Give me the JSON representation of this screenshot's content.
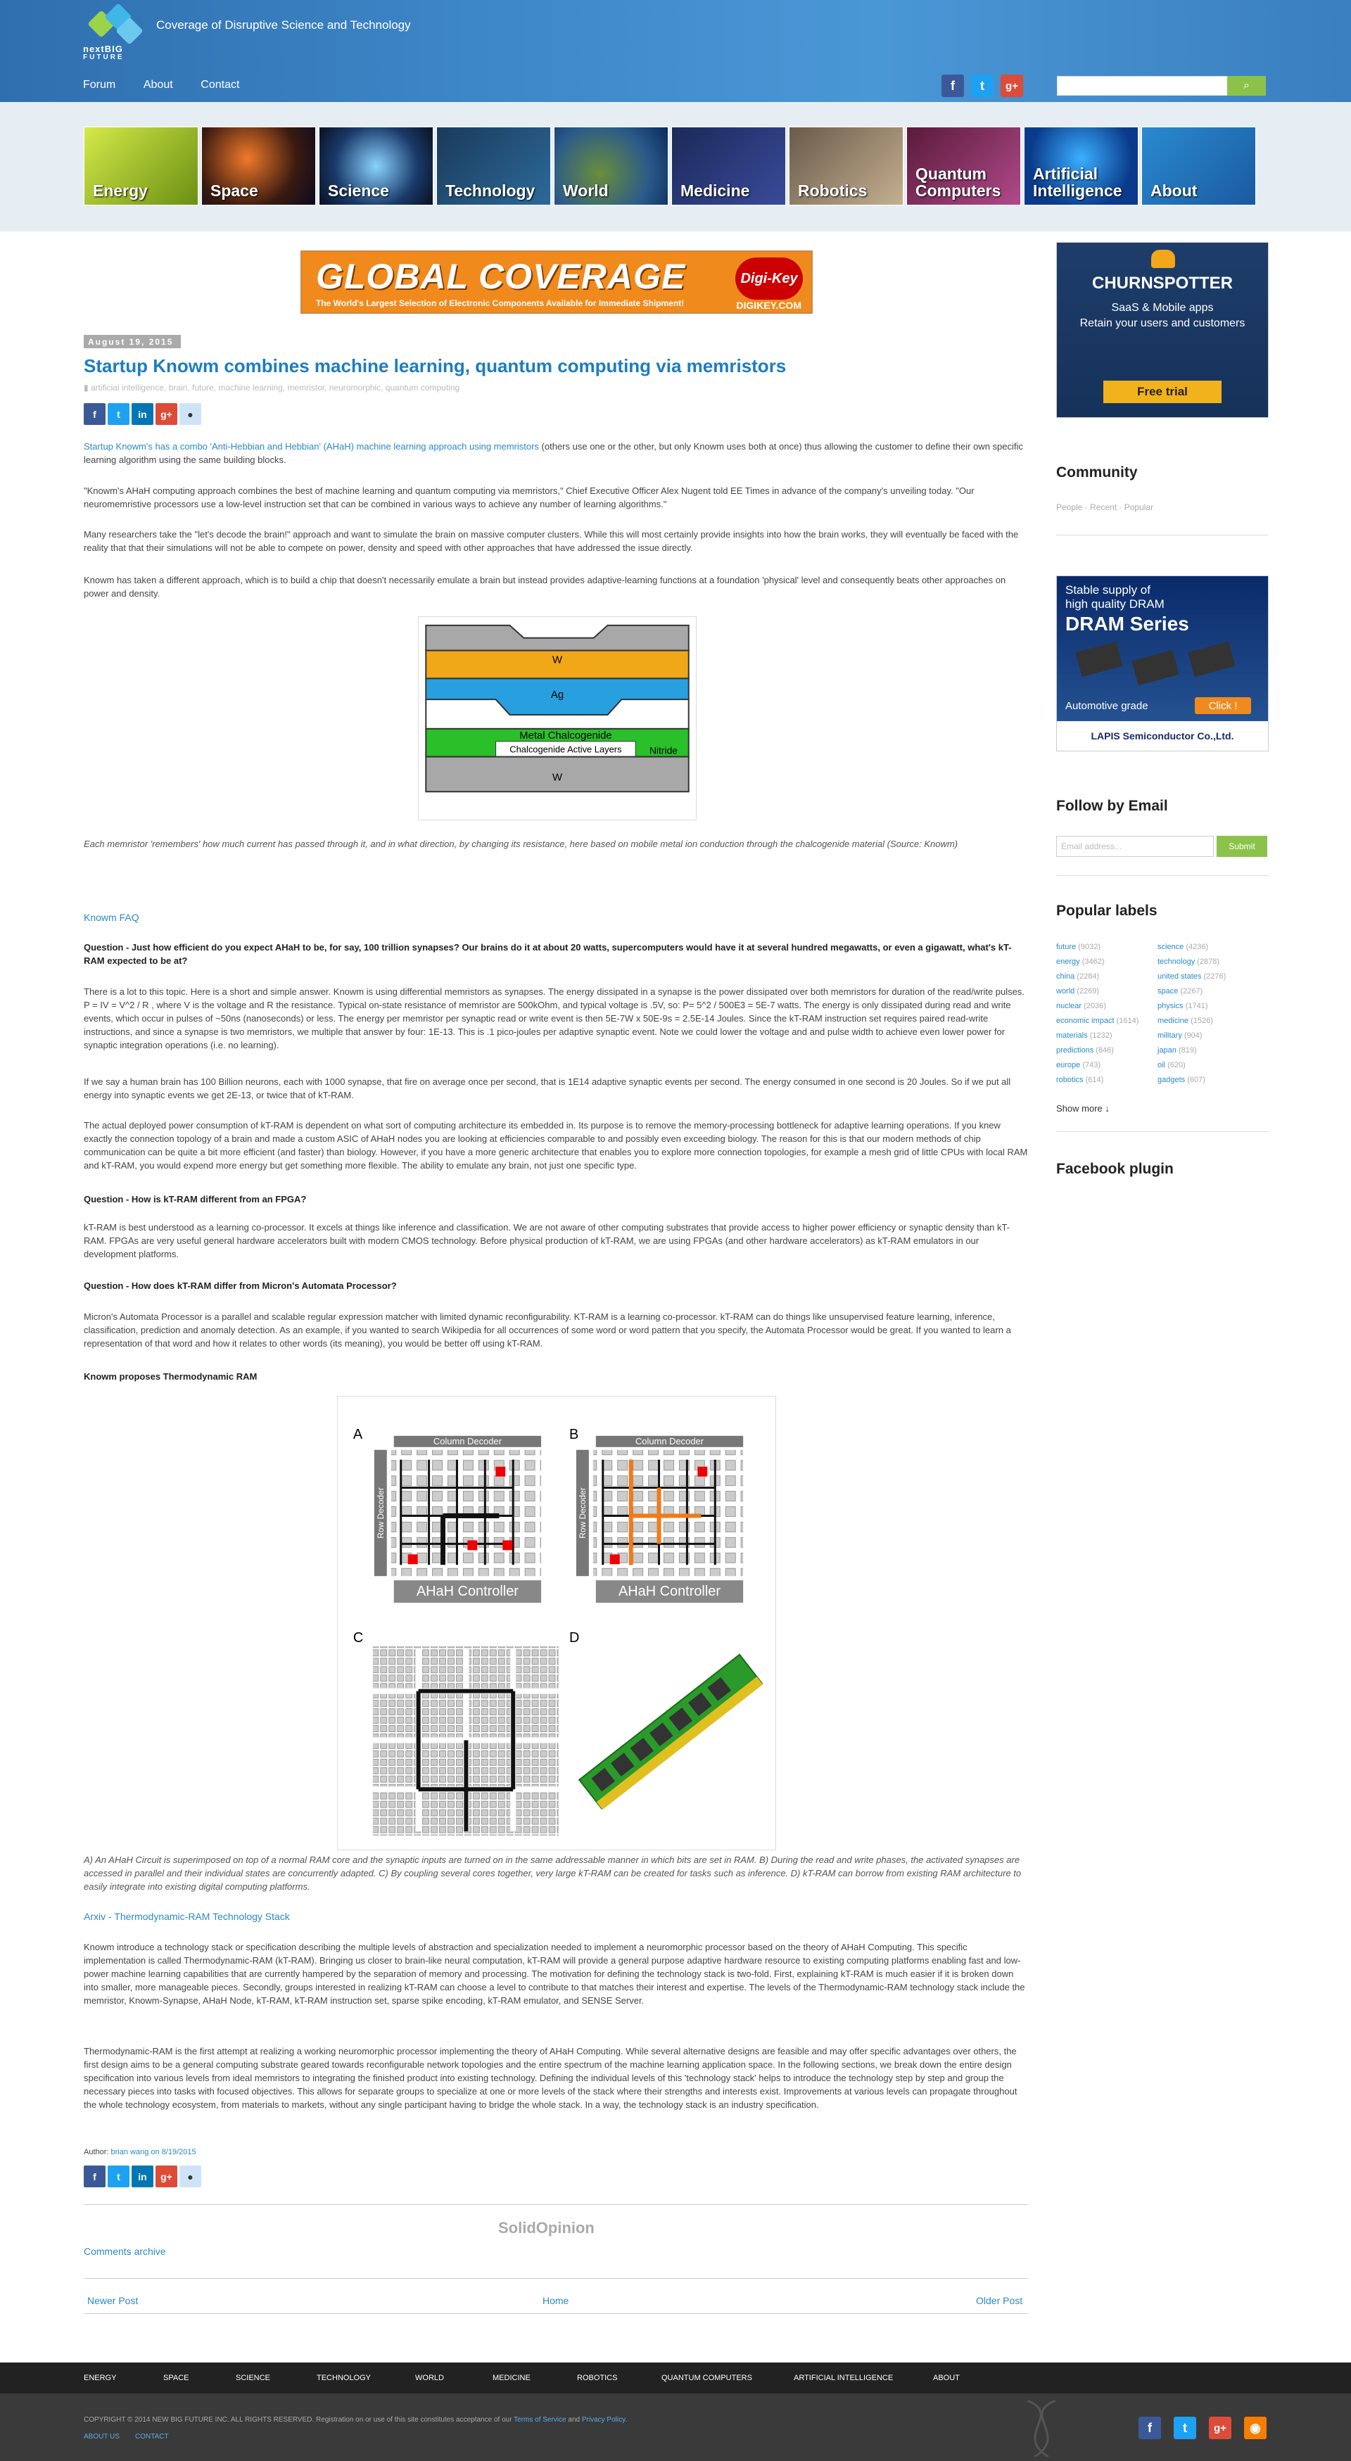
{
  "header": {
    "logo_line1": "nextBIG",
    "logo_line2": "FUTURE",
    "tagline": "Coverage of Disruptive Science and Technology",
    "nav": [
      "Forum",
      "About",
      "Contact"
    ],
    "search_button": "⌕"
  },
  "categories": [
    "Energy",
    "Space",
    "Science",
    "Technology",
    "World",
    "Medicine",
    "Robotics",
    "Quantum Computers",
    "Artificial Intelligence",
    "About"
  ],
  "banner_ad": {
    "headline": "GLOBAL COVERAGE",
    "subline": "The World's Largest Selection of Electronic Components Available for Immediate Shipment!",
    "brand": "Digi-Key",
    "url": "DIGIKEY.COM"
  },
  "article": {
    "date": "August 19, 2015",
    "title": "Startup Knowm combines machine learning, quantum computing via memristors",
    "tags": "artificial intelligence, brain, future, machine learning, memristor, neuromorphic, quantum computing",
    "p1_link": "Startup Knowm's has a combo 'Anti-Hebbian and Hebbian' (AHaH) machine learning approach using memristors",
    "p1_rest": " (others use one or the other, but only Knowm uses both at once) thus allowing the customer to define their own specific learning algorithm using the same building blocks.",
    "p2": "\"Knowm's AHaH computing approach combines the best of machine learning and quantum computing via memristors,\" Chief Executive Officer Alex Nugent told EE Times in advance of the company's unveiling today. \"Our neuromemristive processors use a low-level instruction set that can be combined in various ways to achieve any number of learning algorithms.\"",
    "p3": "Many researchers take the \"let's decode the brain!\" approach and want to simulate the brain on massive computer clusters. While this will most certainly provide insights into how the brain works, they will eventually be faced with the reality that that their simulations will not be able to compete on power, density and speed with other approaches that have addressed the issue directly.",
    "p4": "Knowm has taken a different approach, which is to build a chip that doesn't necessarily emulate a brain but instead provides adaptive-learning functions at a foundation 'physical' level and consequently beats other approaches on power and density.",
    "memristor_layers": [
      "W",
      "Ag",
      "Metal Chalcogenide",
      "Chalcogenide Active Layers",
      "Nitride",
      "W"
    ],
    "memristor_caption": "Each memristor 'remembers' how much current has passed through it, and in what direction, by changing its resistance, here based on mobile metal ion conduction through the chalcogenide material (Source: Knowm)",
    "faq_link": "Knowm FAQ",
    "q1": "Question - Just how efficient do you expect AHaH to be, for say, 100 trillion synapses? Our brains do it at about 20 watts, supercomputers would have it at several hundred megawatts, or even a gigawatt, what's kT-RAM expected to be at?",
    "a1a": "There is a lot to this topic. Here is a short and simple answer. Knowm is using differential memristors as synapses. The energy dissipated in a synapse is the power dissipated over both memristors for duration of the read/write pulses. P = IV = V^2 / R , where V is the voltage and R the resistance. Typical on-state resistance of memristor are 500kOhm, and typical voltage is .5V, so: P= 5^2 / 500E3 = 5E-7 watts. The energy is only dissipated during read and write events, which occur in pulses of ~50ns (nanoseconds) or less. The energy per memristor per synaptic read or write event is then 5E-7W x 50E-9s = 2.5E-14 Joules. Since the kT-RAM instruction set requires paired read-write instructions, and since a synapse is two memristors, we multiple that answer by four: 1E-13. This is .1 pico-joules per adaptive synaptic event. Note we could lower the voltage and and pulse width to achieve even lower power for synaptic integration operations (i.e. no learning).",
    "a1b": "If we say a human brain has 100 Billion neurons, each with 1000 synapse, that fire on average once per second, that is 1E14 adaptive synaptic events per second. The energy consumed in one second is 20 Joules. So if we put all energy into synaptic events we get 2E-13, or twice that of kT-RAM.",
    "a1c": "The actual deployed power consumption of kT-RAM is dependent on what sort of computing architecture its embedded in. Its purpose is to remove the memory-processing bottleneck for adaptive learning operations. If you knew exactly the connection topology of a brain and made a custom ASIC of AHaH nodes you are looking at efficiencies comparable to and possibly even exceeding biology. The reason for this is that our modern methods of chip communication can be quite a bit more efficient (and faster) than biology. However, if you have a more generic architecture that enables you to explore more connection topologies, for example a mesh grid of little CPUs with local RAM and kT-RAM, you would expend more energy but get something more flexible. The ability to emulate any brain, not just one specific type.",
    "q2": "Question - How is kT-RAM different from an FPGA?",
    "a2": "kT-RAM is best understood as a learning co-processor. It excels at things like inference and classification. We are not aware of other computing substrates that provide access to higher power efficiency or synaptic density than kT-RAM. FPGAs are very useful general hardware accelerators built with modern CMOS technology. Before physical production of kT-RAM, we are using FPGAs (and other hardware accelerators) as kT-RAM emulators in our development platforms.",
    "q3": "Question - How does kT-RAM differ from Micron's Automata Processor?",
    "a3": "Micron's Automata Processor is a parallel and scalable regular expression matcher with limited dynamic reconfigurability. KT-RAM is a learning co-processor. kT-RAM can do things like unsupervised feature learning, inference, classification, prediction and anomaly detection. As an example, if you wanted to search Wikipedia for all occurrences of some word or word pattern that you specify, the Automata Processor would be great. If you wanted to learn a representation of that word and how it relates to other words (its meaning), you would be better off using kT-RAM.",
    "thermo_heading": "Knowm proposes Thermodynamic RAM",
    "ktram_panels": [
      "A",
      "B",
      "C",
      "D"
    ],
    "ktram_col_decoder": "Column Decoder",
    "ktram_row_decoder": "Row Decoder",
    "ktram_controller": "AHaH Controller",
    "ktram_caption": "A) An AHaH Circuit is superimposed on top of a normal RAM core and the synaptic inputs are turned on in the same addressable manner in which bits are set in RAM. B) During the read and write phases, the activated synapses are accessed in parallel and their individual states are concurrently adapted. C) By coupling several cores together, very large kT-RAM can be created for tasks such as inference. D) kT-RAM can borrow from existing RAM architecture to easily integrate into existing digital computing platforms.",
    "arxiv_link": "Arxiv - Thermodynamic-RAM Technology Stack",
    "p_stack1": "Knowm introduce a technology stack or specification describing the multiple levels of abstraction and specialization needed to implement a neuromorphic processor based on the theory of AHaH Computing. This specific implementation is called Thermodynamic-RAM (kT-RAM). Bringing us closer to brain-like neural computation, kT-RAM will provide a general purpose adaptive hardware resource to existing computing platforms enabling fast and low-power machine learning capabilities that are currently hampered by the separation of memory and processing. The motivation for defining the technology stack is two-fold. First, explaining kT-RAM is much easier if it is broken down into smaller, more manageable pieces. Secondly, groups interested in realizing kT-RAM can choose a level to contribute to that matches their interest and expertise. The levels of the Thermodynamic-RAM technology stack include the memristor, Knowm-Synapse, AHaH Node, kT-RAM, kT-RAM instruction set, sparse spike encoding, kT-RAM emulator, and SENSE Server.",
    "p_stack2": "Thermodynamic-RAM is the first attempt at realizing a working neuromorphic processor implementing the theory of AHaH Computing. While several alternative designs are feasible and may offer specific advantages over others, the first design aims to be a general computing substrate geared towards reconfigurable network topologies and the entire spectrum of the machine learning application space. In the following sections, we break down the entire design specification into various levels from ideal memristors to integrating the finished product into existing technology. Defining the individual levels of this 'technology stack' helps to introduce the technology step by step and group the necessary pieces into tasks with focused objectives. This allows for separate groups to specialize at one or more levels of the stack where their strengths and interests exist. Improvements at various levels can propagate throughout the whole technology ecosystem, from materials to markets, without any single participant having to bridge the whole stack. In a way, the technology stack is an industry specification.",
    "author_label": "Author: ",
    "author_link": "brian wang on 8/19/2015",
    "solidopinion": "SolidOpinion",
    "comments_archive": "Comments archive",
    "pager": {
      "newer": "Newer Post",
      "home": "Home",
      "older": "Older Post"
    }
  },
  "sidebar": {
    "ad1": {
      "brand": "CHURNSPOTTER",
      "line1": "SaaS & Mobile apps",
      "line2": "Retain your users and customers",
      "cta": "Free trial"
    },
    "community": {
      "heading": "Community",
      "links": "People · Recent · Popular"
    },
    "ad2": {
      "line1": "Stable supply of",
      "line2": "high quality DRAM",
      "series": "DRAM Series",
      "grade": "Automotive grade",
      "cta": "Click !",
      "brand": "LAPIS Semiconductor Co.,Ltd."
    },
    "follow": {
      "heading": "Follow by Email",
      "placeholder": "Email address...",
      "submit": "Submit"
    },
    "labels_heading": "Popular labels",
    "labels": [
      [
        "future",
        "(9032)",
        "science",
        "(4236)"
      ],
      [
        "energy",
        "(3462)",
        "technology",
        "(2878)"
      ],
      [
        "china",
        "(2284)",
        "united states",
        "(2276)"
      ],
      [
        "world",
        "(2269)",
        "space",
        "(2267)"
      ],
      [
        "nuclear",
        "(2036)",
        "physics",
        "(1741)"
      ],
      [
        "economic impact",
        "(1614)",
        "medicine",
        "(1526)"
      ],
      [
        "materials",
        "(1232)",
        "military",
        "(904)"
      ],
      [
        "predictions",
        "(846)",
        "japan",
        "(819)"
      ],
      [
        "europe",
        "(743)",
        "oil",
        "(620)"
      ],
      [
        "robotics",
        "(614)",
        "gadgets",
        "(607)"
      ]
    ],
    "show_more": "Show more ↓",
    "facebook_heading": "Facebook plugin"
  },
  "footer": {
    "links": [
      "ENERGY",
      "SPACE",
      "SCIENCE",
      "TECHNOLOGY",
      "WORLD",
      "MEDICINE",
      "ROBOTICS",
      "QUANTUM COMPUTERS",
      "ARTIFICIAL INTELLIGENCE",
      "ABOUT"
    ],
    "copyright": "COPYRIGHT © 2014 NEW BIG FUTURE INC. ALL RIGHTS RESERVED. Registration on or use of this site constitutes acceptance of our",
    "tos": "Terms of Service",
    "and": "and",
    "privacy": "Privacy Policy.",
    "bottom_links": [
      "ABOUT US",
      "CONTACT"
    ]
  }
}
